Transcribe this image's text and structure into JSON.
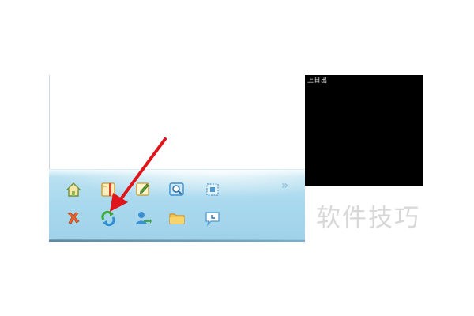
{
  "panel": {
    "text": "上日出"
  },
  "watermark": {
    "text": "软件技巧"
  },
  "toolbar": {
    "overflow_chevron": "»",
    "row1": [
      {
        "name": "home-icon"
      },
      {
        "name": "book-icon"
      },
      {
        "name": "edit-note-icon"
      },
      {
        "name": "image-search-icon"
      },
      {
        "name": "screenshot-icon"
      }
    ],
    "row2": [
      {
        "name": "tools-icon"
      },
      {
        "name": "refresh-icon"
      },
      {
        "name": "user-share-icon"
      },
      {
        "name": "folder-icon"
      },
      {
        "name": "chat-icon"
      }
    ]
  },
  "colors": {
    "toolbar_bg": "#aad9ee",
    "arrow": "#e0141b",
    "watermark": "#d8d8d8",
    "icon_yellow": "#f2c24e",
    "icon_green": "#3ea83a",
    "icon_blue": "#3c8fd0",
    "icon_orange": "#e8652c"
  }
}
